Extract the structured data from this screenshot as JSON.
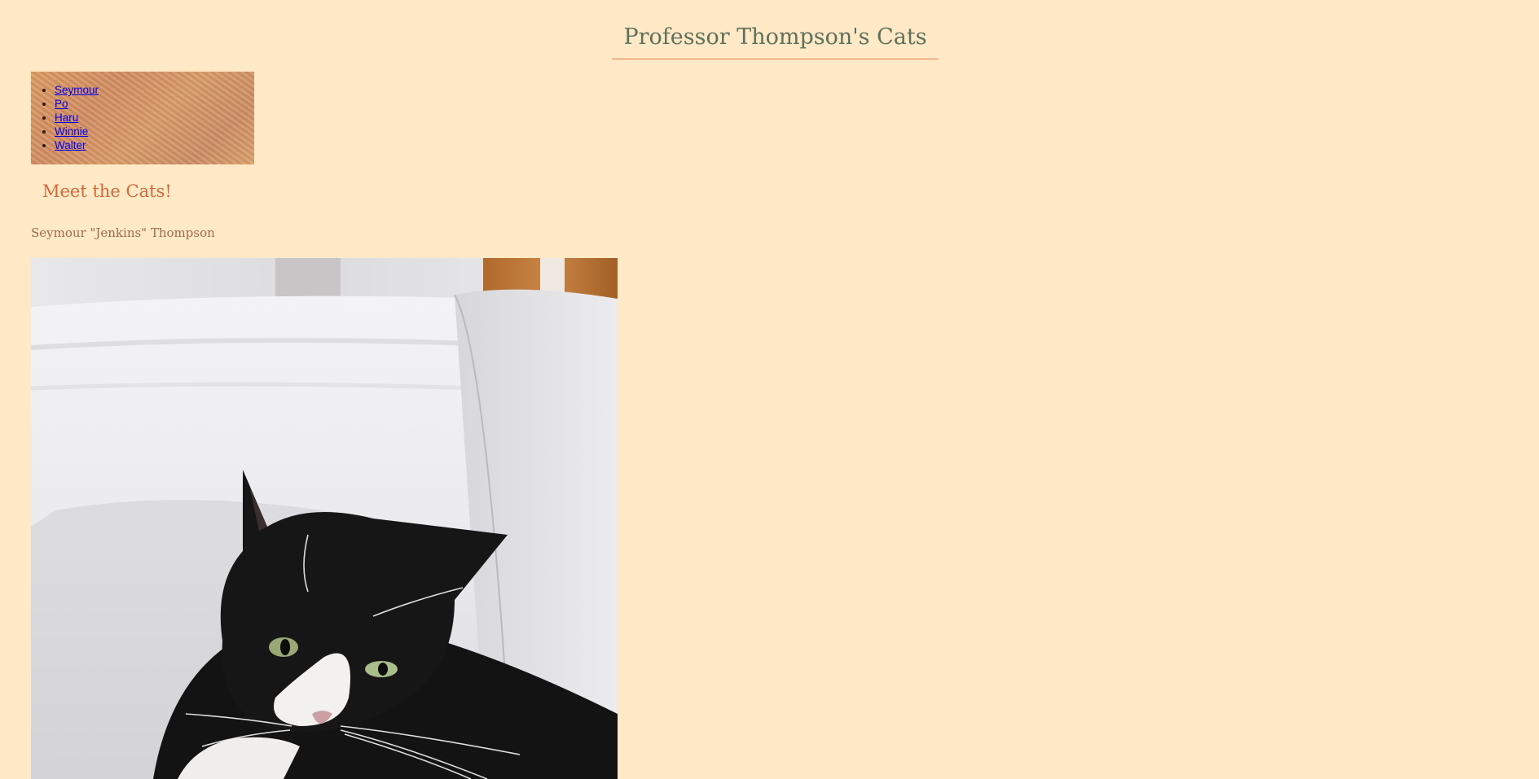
{
  "header": {
    "title": "Professor Thompson's Cats"
  },
  "nav": {
    "items": [
      {
        "label": "Seymour"
      },
      {
        "label": "Po"
      },
      {
        "label": "Haru"
      },
      {
        "label": "Winnie"
      },
      {
        "label": "Walter"
      }
    ]
  },
  "main": {
    "heading": "Meet the Cats!",
    "cats": [
      {
        "name": "Seymour \"Jenkins\" Thompson"
      }
    ]
  },
  "colors": {
    "background": "#ffe9c6",
    "title": "#5f6f5c",
    "accent": "#d5683a",
    "cat_name": "#a06a4e",
    "link": "#0000ee"
  }
}
